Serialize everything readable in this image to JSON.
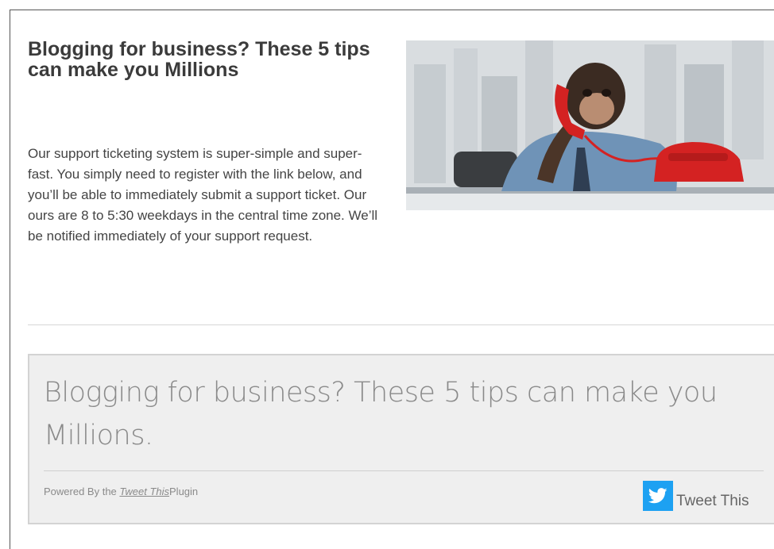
{
  "post": {
    "title": "Blogging for business? These 5 tips can make you Millions",
    "body": "Our support ticketing system is super-simple and super-fast. You simply need to register with the link below, and you’ll be able to immediately submit a support ticket. Our ours are 8 to 5:30 weekdays in the central time zone. We’ll be notified immediately of your support request.",
    "image_alt": "chimp-on-phone-photo"
  },
  "tweet_box": {
    "quote": "Blogging for business? These 5 tips can make you Millions.",
    "powered_prefix": "Powered By the",
    "plugin_link": "Tweet This",
    "powered_suffix": "Plugin",
    "button_label": "Tweet This",
    "icon": "twitter-bird-icon",
    "icon_color": "#1da1f2"
  }
}
